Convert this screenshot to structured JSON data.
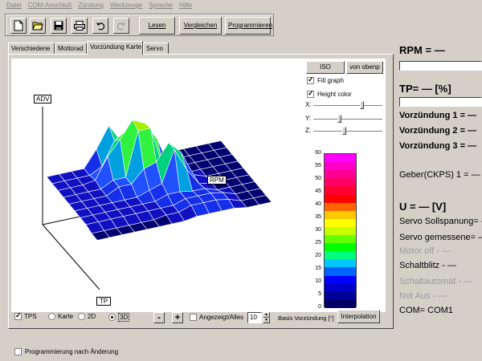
{
  "menu": [
    "Datei",
    "COM-Anschluß",
    "Zündung",
    "Werkzeuge",
    "Sprache",
    "Hilfe"
  ],
  "toolbar": {
    "icons": [
      "new-file-icon",
      "open-folder-icon",
      "save-disk-icon",
      "print-icon",
      "undo-icon",
      "redo-icon"
    ],
    "lesen": "Lesen",
    "vergleichen": "Vergleichen",
    "programmieren": "Programmieren"
  },
  "tabs": [
    "Verschiedene",
    "Mottorad",
    "Vorzündung Karte",
    "Servo"
  ],
  "plot": {
    "axis_adv": "ADV",
    "axis_rpm": "RPM",
    "axis_tp": "TP",
    "surface_rows": [
      [
        1,
        1,
        1,
        1,
        9,
        19,
        10,
        9,
        3,
        0,
        0,
        0,
        0,
        0,
        0
      ],
      [
        1,
        1,
        1,
        1,
        4,
        15,
        19,
        9,
        3,
        0,
        0,
        0,
        0,
        0,
        0
      ],
      [
        1,
        1,
        1,
        2,
        12,
        19,
        27,
        24,
        15,
        0,
        0,
        0,
        0,
        0,
        0
      ],
      [
        1,
        1,
        1,
        1,
        4,
        4,
        25,
        25,
        5,
        3,
        0,
        0,
        0,
        0,
        0
      ],
      [
        1,
        1,
        1,
        1,
        4,
        4,
        10,
        12,
        20,
        14,
        2,
        0,
        0,
        0,
        0
      ],
      [
        1,
        1,
        1,
        1,
        1,
        1,
        3,
        5,
        20,
        9,
        1,
        0,
        0,
        0,
        0
      ],
      [
        1,
        1,
        1,
        1,
        1,
        1,
        1,
        3,
        3,
        2,
        2,
        0,
        0,
        0,
        0
      ],
      [
        1,
        1,
        1,
        1,
        1,
        1,
        1,
        1,
        3,
        3,
        3,
        2,
        0,
        0,
        0
      ],
      [
        0,
        0,
        0,
        0,
        0,
        0,
        1,
        1,
        3,
        3,
        3,
        2,
        0,
        0,
        0
      ],
      [
        0,
        0,
        0,
        0,
        0,
        0,
        0,
        0,
        1,
        1,
        1,
        1,
        0,
        0,
        0
      ]
    ]
  },
  "view": {
    "iso": "ISO",
    "von_obenp": "von obenp",
    "fill_graph": "Fill graph",
    "height_color": "Height color",
    "x": "X:",
    "y": "Y:",
    "z": "Z:",
    "x_pos": 0.72,
    "y_pos": 0.38,
    "z_pos": 0.45
  },
  "color_scale": {
    "ticks": [
      "60",
      "55",
      "50",
      "45",
      "40",
      "35",
      "30",
      "25",
      "20",
      "15",
      "10",
      "5",
      "0"
    ],
    "colors": [
      "#ff00ff",
      "#ff00c8",
      "#ff0096",
      "#ff0064",
      "#ff0032",
      "#ff0000",
      "#ff6400",
      "#ffc800",
      "#ffff00",
      "#c8ff00",
      "#64ff00",
      "#00ff00",
      "#00ff80",
      "#00c8ff",
      "#0064ff",
      "#0000ff",
      "#0000c8",
      "#000096",
      "#000064"
    ]
  },
  "bottom": {
    "tps": "TPS",
    "karte": "Karte",
    "two_d": "2D",
    "three_d": "3D",
    "minus": "-",
    "plus": "+",
    "angezeigt": "Angezeigt/Alles",
    "spin_value": "10",
    "basis": "Basis Vorzündung [°]",
    "interpolation": "Interpolation",
    "programmierung": "Programmierung nach Änderung"
  },
  "status": {
    "rpm": "RPM = —",
    "tp": "TP= — [%]",
    "vz1": "Vorzündung 1 = —",
    "vz2": "Vorzündung 2 = —",
    "vz3": "Vorzündung 3 = —",
    "geber": "Geber(CKPS) 1 = —",
    "u": "U = — [V]",
    "servo_soll": "Servo Sollspanung= —",
    "servo_gem": "Servo gemessene= —",
    "motor_off": "Motor off - —",
    "schaltblitz": "Schaltblitz - —",
    "schaltautomat": "Schaltautomat - —",
    "notaus": "Not Aus - —",
    "com": "COM= COM1"
  }
}
